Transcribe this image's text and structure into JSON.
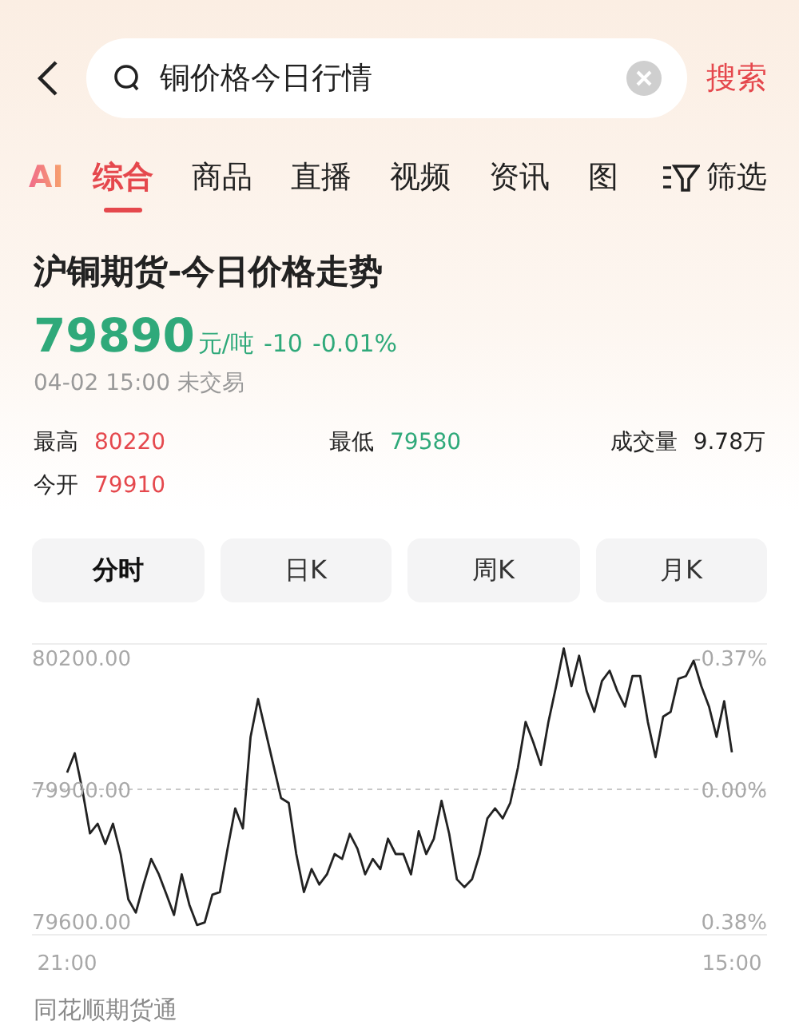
{
  "search": {
    "value": "铜价格今日行情",
    "action": "搜索"
  },
  "tabs": [
    {
      "label": "AI",
      "kind": "ai",
      "selected": false
    },
    {
      "label": "综合",
      "kind": "text",
      "selected": true
    },
    {
      "label": "商品",
      "kind": "text",
      "selected": false
    },
    {
      "label": "直播",
      "kind": "text",
      "selected": false
    },
    {
      "label": "视频",
      "kind": "text",
      "selected": false
    },
    {
      "label": "资讯",
      "kind": "text",
      "selected": false
    },
    {
      "label": "图",
      "kind": "text",
      "selected": false
    }
  ],
  "filter": {
    "label": "筛选"
  },
  "quote": {
    "title": "沪铜期货-今日价格走势",
    "price": "79890",
    "unit": "元/吨",
    "change": "-10",
    "change_pct": "-0.01%",
    "time": "04-02 15:00 未交易",
    "stats": [
      {
        "label": "最高",
        "value": "80220",
        "color": "#e5484d"
      },
      {
        "label": "最低",
        "value": "79580",
        "color": "#2fa97a"
      },
      {
        "label": "成交量",
        "value": "9.78万",
        "color": "#222222"
      },
      {
        "label": "今开",
        "value": "79910",
        "color": "#e5484d"
      }
    ]
  },
  "periods": [
    {
      "label": "分时",
      "selected": true
    },
    {
      "label": "日K",
      "selected": false
    },
    {
      "label": "周K",
      "selected": false
    },
    {
      "label": "月K",
      "selected": false
    }
  ],
  "chart": {
    "right_axis_labels": [
      "-0.37%",
      "0.00%",
      "0.38%"
    ],
    "chart_data": {
      "type": "line",
      "categories": [
        "21:00",
        null,
        null,
        null,
        null,
        null,
        null,
        null,
        null,
        null,
        null,
        null,
        null,
        null,
        null,
        null,
        null,
        null,
        null,
        null,
        null,
        null,
        null,
        null,
        null,
        null,
        null,
        null,
        null,
        null,
        null,
        null,
        null,
        null,
        null,
        null,
        null,
        null,
        null,
        null,
        null,
        null,
        null,
        null,
        null,
        null,
        null,
        null,
        null,
        null,
        null,
        null,
        null,
        null,
        null,
        null,
        null,
        null,
        null,
        null,
        null,
        null,
        null,
        null,
        null,
        null,
        null,
        null,
        null,
        null,
        null,
        null,
        null,
        null,
        null,
        null,
        null,
        null,
        null,
        null,
        null,
        null,
        null,
        null,
        null,
        null,
        null,
        "15:00"
      ],
      "series": [
        {
          "color": "#222222",
          "values": [
            79938,
            79982,
            79898,
            79800,
            79822,
            79776,
            79822,
            79753,
            79650,
            79620,
            79684,
            79742,
            79707,
            79661,
            79615,
            79707,
            79638,
            79592,
            79598,
            79661,
            79667,
            79765,
            79857,
            79811,
            80019,
            80105,
            80030,
            79955,
            79880,
            79869,
            79753,
            79667,
            79719,
            79684,
            79707,
            79753,
            79742,
            79799,
            79765,
            79707,
            79742,
            79719,
            79788,
            79753,
            79753,
            79707,
            79805,
            79753,
            79788,
            79874,
            79799,
            79696,
            79678,
            79696,
            79753,
            79834,
            79857,
            79834,
            79869,
            79949,
            80053,
            80007,
            79955,
            80053,
            80134,
            80220,
            80134,
            80203,
            80123,
            80076,
            80146,
            80169,
            80123,
            80088,
            80157,
            80157,
            80053,
            79973,
            80065,
            80076,
            80151,
            80157,
            80192,
            80134,
            80088,
            80019,
            80100,
            79984
          ]
        }
      ],
      "ylim": [
        79570,
        80230
      ],
      "yticks": [
        {
          "value": 80200,
          "label": "80200.00"
        },
        {
          "value": 79900,
          "label": "79900.00"
        },
        {
          "value": 79600,
          "label": "79600.00"
        }
      ]
    }
  },
  "footer": {
    "source": "同花顺期货通"
  }
}
